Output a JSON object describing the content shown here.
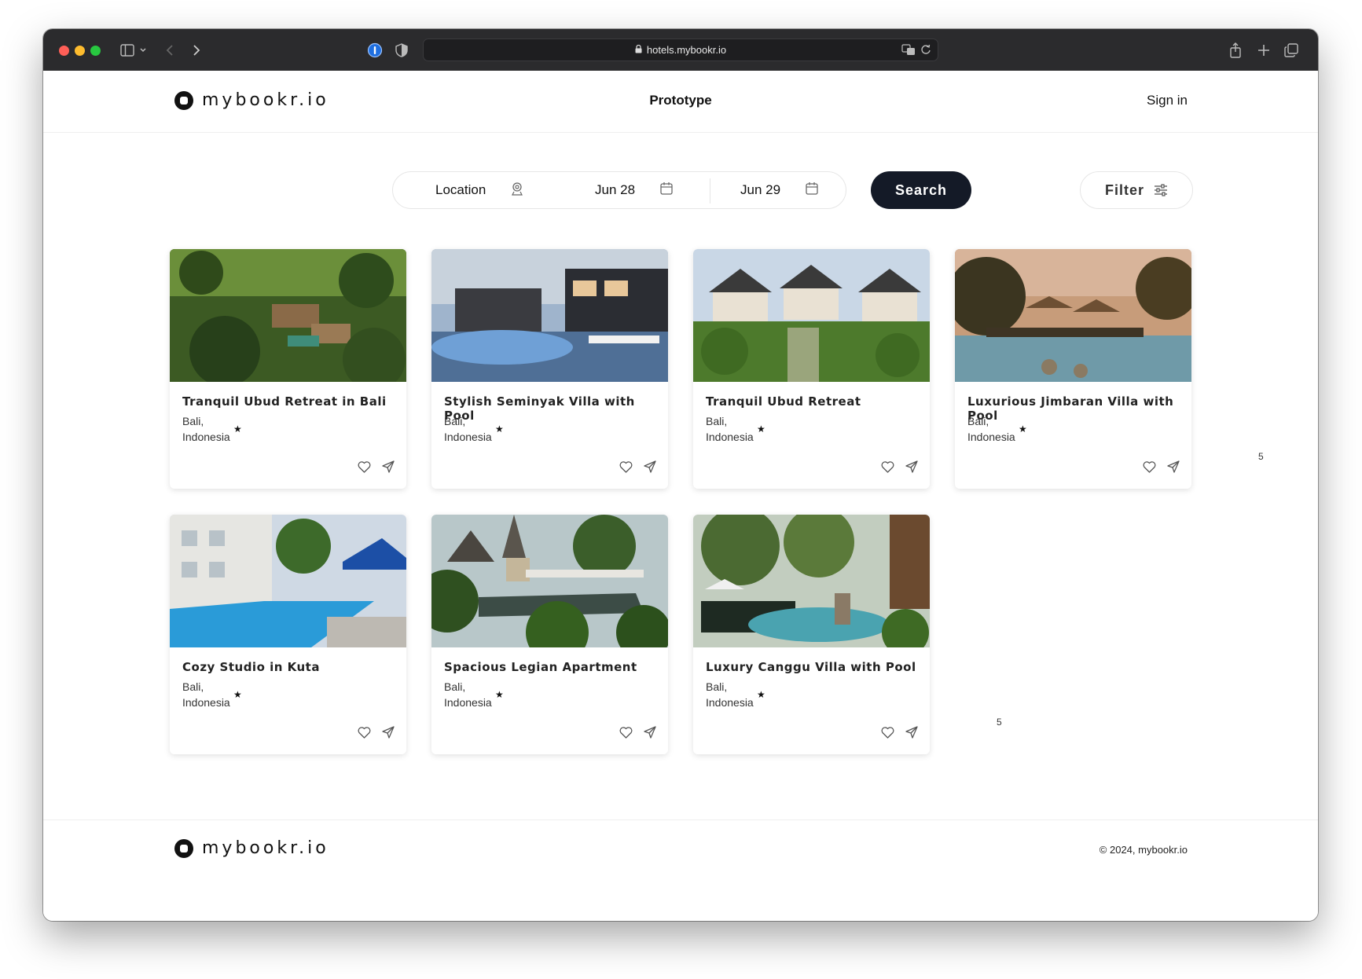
{
  "browser": {
    "url": "hotels.mybookr.io",
    "traffic_lights": [
      "#ff5f57",
      "#febc2e",
      "#28c840"
    ]
  },
  "header": {
    "logo_text": "mybookr.io",
    "nav_title": "Prototype",
    "signin_label": "Sign in"
  },
  "search": {
    "location_label": "Location",
    "check_in": "Jun 28",
    "check_out": "Jun 29",
    "search_label": "Search",
    "filter_label": "Filter"
  },
  "listings": [
    {
      "title": "Tranquil Ubud Retreat in Bali",
      "region": "Bali,",
      "country": "Indonesia",
      "star": "★",
      "scene": "jungle-aerial"
    },
    {
      "title": "Stylish Seminyak Villa with Pool",
      "region": "Bali,",
      "country": "Indonesia",
      "star": "★",
      "scene": "modern-pool"
    },
    {
      "title": "Tranquil Ubud Retreat",
      "region": "Bali,",
      "country": "Indonesia",
      "star": "★",
      "scene": "villa-garden"
    },
    {
      "title": "Luxurious Jimbaran Villa with Pool",
      "region": "Bali,",
      "country": "Indonesia",
      "star": "★",
      "scene": "sunset-pool"
    },
    {
      "title": "Cozy Studio in Kuta",
      "region": "Bali,",
      "country": "Indonesia",
      "star": "★",
      "scene": "hotel-pool"
    },
    {
      "title": "Spacious Legian Apartment",
      "region": "Bali,",
      "country": "Indonesia",
      "star": "★",
      "scene": "tropical-resort"
    },
    {
      "title": "Luxury Canggu Villa with Pool",
      "region": "Bali,",
      "country": "Indonesia",
      "star": "★",
      "scene": "garden-pool"
    }
  ],
  "stray_labels": [
    "5",
    "5"
  ],
  "footer": {
    "logo_text": "mybookr.io",
    "copyright": "© 2024, mybookr.io"
  },
  "colors": {
    "titlebar": "#2b2b2d",
    "search_button": "#141a27",
    "text": "#111111"
  }
}
